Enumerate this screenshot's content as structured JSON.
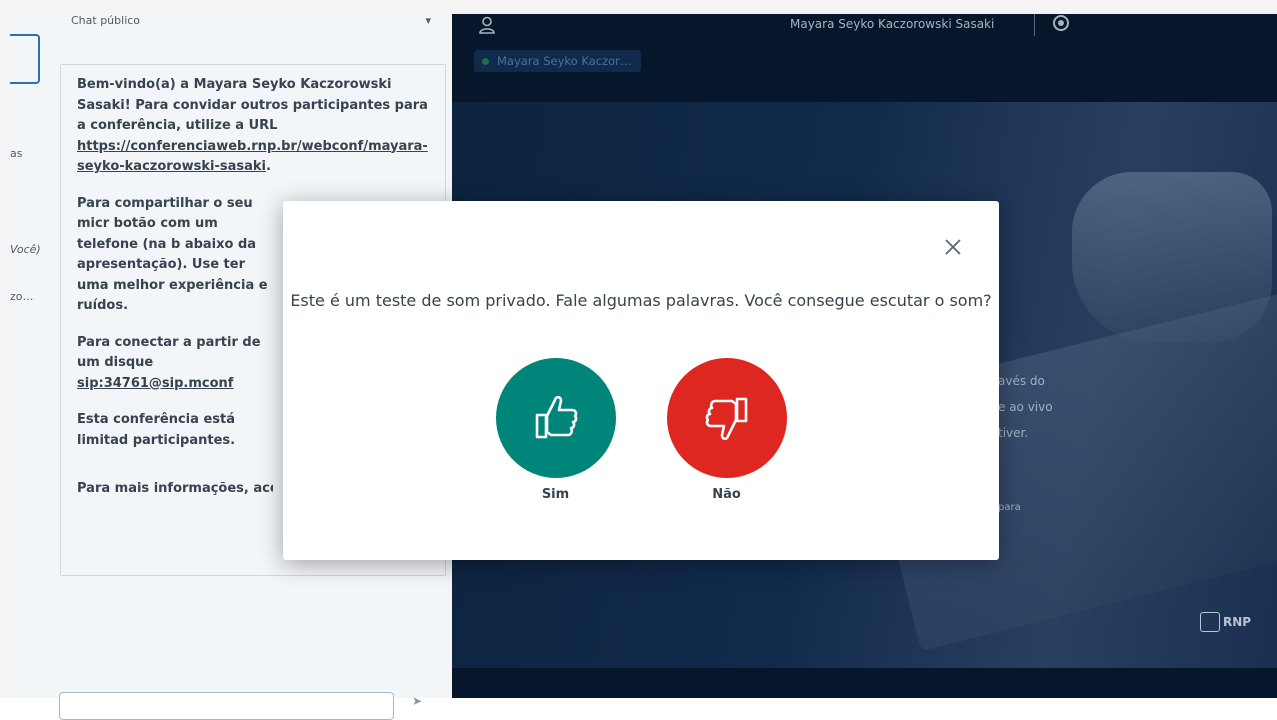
{
  "userlist": {
    "items": [
      "as",
      "Você)",
      "zo…"
    ]
  },
  "chat": {
    "header": "Chat público",
    "welcome": {
      "p1_prefix": "Bem-vindo(a) a Mayara Seyko Kaczorowski Sasaki! Para convidar outros participantes para a conferência, utilize a URL ",
      "p1_link": "https://conferenciaweb.rnp.br/webconf/mayara-seyko-kaczorowski-sasaki",
      "p1_suffix": ".",
      "p2": "Para compartilhar o seu micr botão com um telefone (na b abaixo da apresentação). Use ter uma melhor experiência e ruídos.",
      "p3_prefix": "Para conectar a partir de um disque ",
      "p3_link": "sip:34761@sip.mconf",
      "p4": "Esta conferência está limitad participantes.",
      "p5": "Para mais informações, aces"
    }
  },
  "navbar": {
    "user_name": "Mayara Seyko Kaczorowski Sasaki",
    "talking_indicator": "Mayara Seyko Kaczor…"
  },
  "slide": {
    "text_a": "avés do",
    "text_b": "e ao vivo",
    "text_c": "tiver.",
    "text_d": "para",
    "logo": "RNP"
  },
  "modal": {
    "question": "Este é um teste de som privado. Fale algumas palavras. Você consegue escutar o som?",
    "yes_label": "Sim",
    "no_label": "Não"
  },
  "colors": {
    "yes": "#00857a",
    "no": "#df2721",
    "background_dark": "#06172c",
    "panel": "#f3f6f9"
  }
}
